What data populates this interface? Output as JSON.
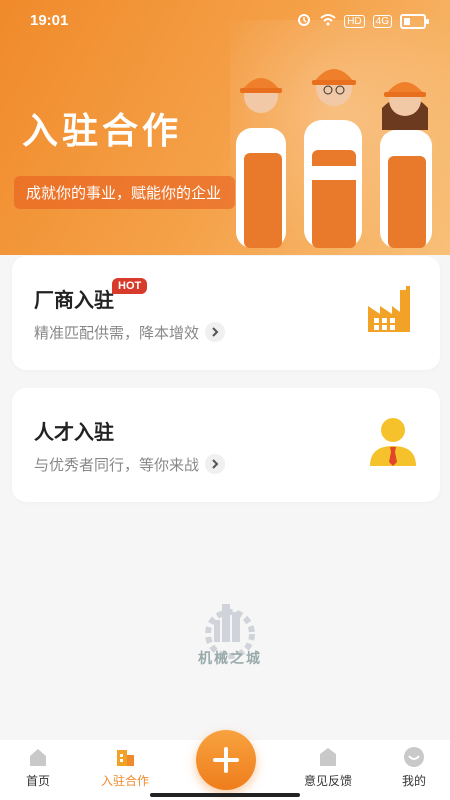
{
  "status": {
    "time": "19:01",
    "hd": "HD",
    "net": "4G"
  },
  "hero": {
    "title": "入驻合作",
    "subtitle": "成就你的事业，赋能你的企业"
  },
  "cards": [
    {
      "title": "厂商入驻",
      "badge": "HOT",
      "desc": "精准匹配供需，降本增效",
      "icon": "factory-icon"
    },
    {
      "title": "人才入驻",
      "desc": "与优秀者同行，等你来战",
      "icon": "person-icon"
    }
  ],
  "watermark": {
    "text": "机械之城"
  },
  "tabbar": {
    "items": [
      {
        "label": "首页",
        "icon": "home-icon"
      },
      {
        "label": "入驻合作",
        "icon": "building-icon",
        "active": true
      },
      {
        "label": "",
        "icon": "plus-icon"
      },
      {
        "label": "意见反馈",
        "icon": "feedback-icon"
      },
      {
        "label": "我的",
        "icon": "profile-icon"
      }
    ]
  },
  "colors": {
    "accent": "#f08a2a",
    "hot": "#d83b2b"
  }
}
